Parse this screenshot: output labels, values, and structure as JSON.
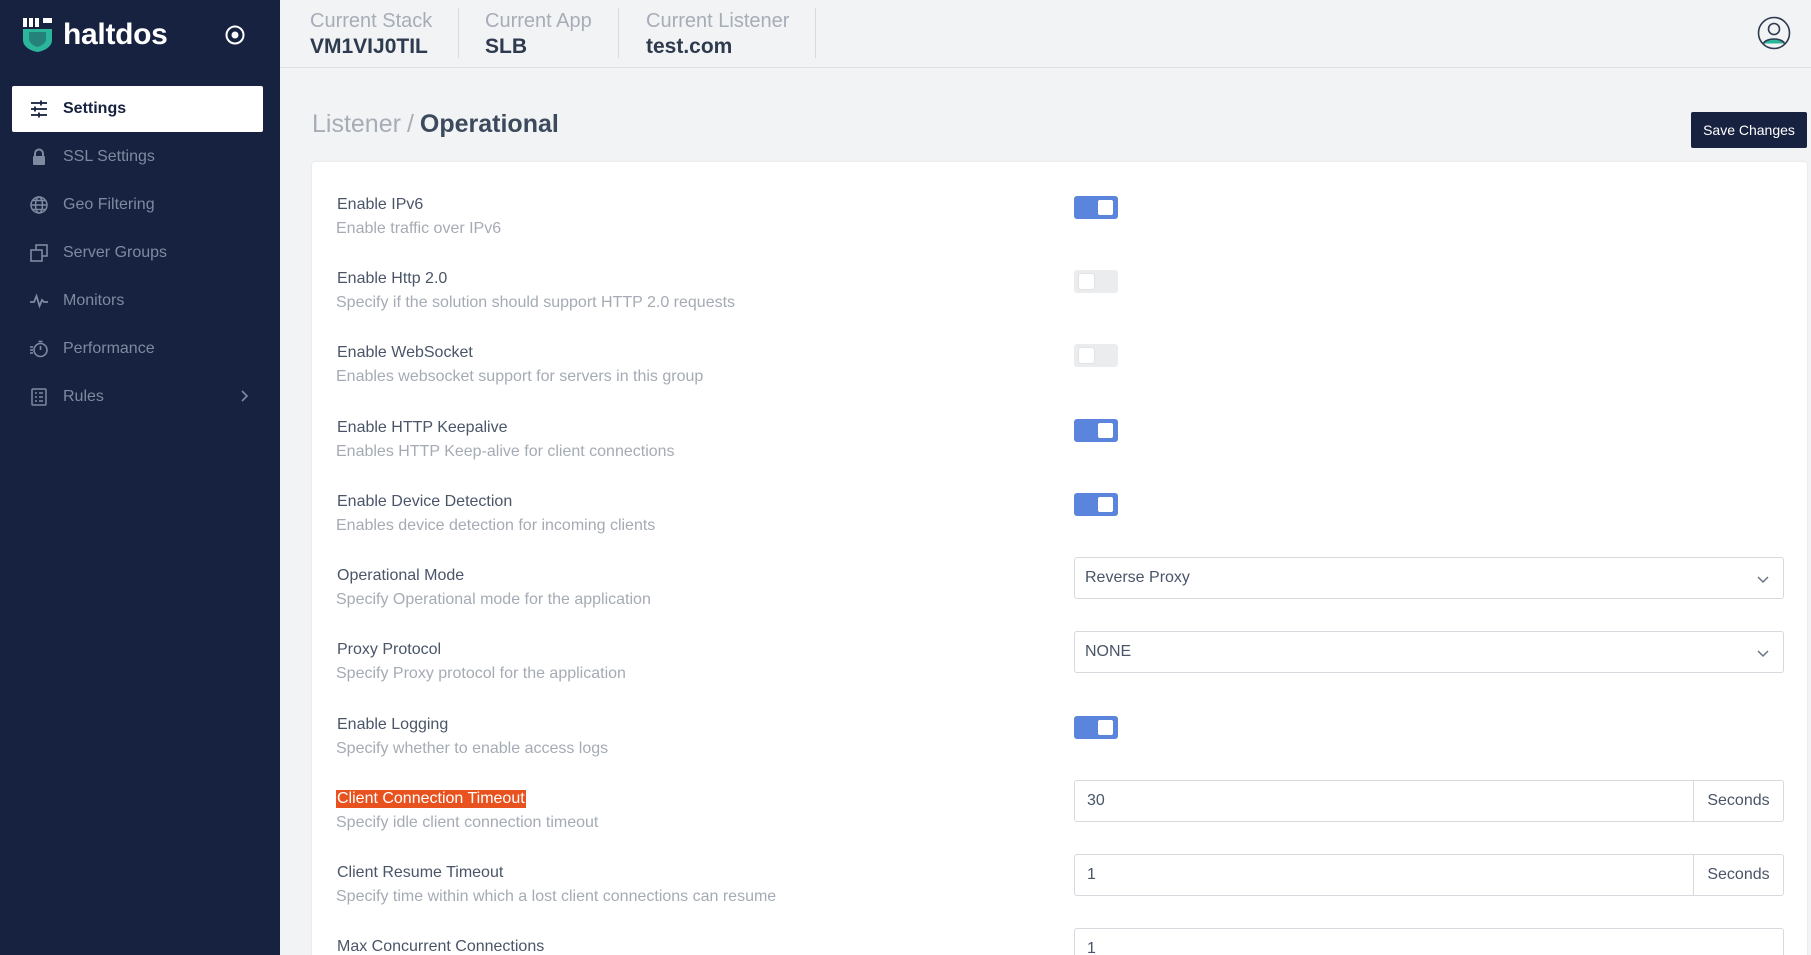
{
  "brand": {
    "name": "haltdos"
  },
  "sidebar": {
    "items": [
      {
        "label": "Settings",
        "icon": "sliders-icon",
        "active": true
      },
      {
        "label": "SSL Settings",
        "icon": "lock-icon"
      },
      {
        "label": "Geo Filtering",
        "icon": "globe-icon"
      },
      {
        "label": "Server Groups",
        "icon": "server-groups-icon"
      },
      {
        "label": "Monitors",
        "icon": "pulse-icon"
      },
      {
        "label": "Performance",
        "icon": "stopwatch-icon"
      },
      {
        "label": "Rules",
        "icon": "list-icon",
        "has_submenu": true
      }
    ]
  },
  "topbar": {
    "stack": {
      "label": "Current Stack",
      "value": "VM1VIJ0TIL"
    },
    "app": {
      "label": "Current App",
      "value": "SLB"
    },
    "listener": {
      "label": "Current Listener",
      "value": "test.com"
    }
  },
  "header": {
    "breadcrumb_parent": "Listener",
    "breadcrumb_sep": "/",
    "breadcrumb_current": "Operational",
    "save_label": "Save Changes"
  },
  "settings": {
    "ipv6": {
      "label": "Enable IPv6",
      "desc": "Enable traffic over IPv6",
      "on": true
    },
    "http2": {
      "label": "Enable Http 2.0",
      "desc": "Specify if the solution should support HTTP 2.0 requests",
      "on": false
    },
    "websocket": {
      "label": "Enable WebSocket",
      "desc": "Enables websocket support for servers in this group",
      "on": false
    },
    "keepalive": {
      "label": "Enable HTTP Keepalive",
      "desc": "Enables HTTP Keep-alive for client connections",
      "on": true
    },
    "device": {
      "label": "Enable Device Detection",
      "desc": "Enables device detection for incoming clients",
      "on": true
    },
    "mode": {
      "label": "Operational Mode",
      "desc": "Specify Operational mode for the application",
      "value": "Reverse Proxy"
    },
    "proxy_protocol": {
      "label": "Proxy Protocol",
      "desc": "Specify Proxy protocol for the application",
      "value": "NONE"
    },
    "logging": {
      "label": "Enable Logging",
      "desc": "Specify whether to enable access logs",
      "on": true
    },
    "conn_timeout": {
      "label": "Client Connection Timeout",
      "desc": "Specify idle client connection timeout",
      "value": "30",
      "unit": "Seconds"
    },
    "resume_timeout": {
      "label": "Client Resume Timeout",
      "desc": "Specify time within which a lost client connections can resume",
      "value": "1",
      "unit": "Seconds"
    },
    "max_conn": {
      "label": "Max Concurrent Connections",
      "value": "1"
    }
  },
  "colors": {
    "sidebar_bg": "#172240",
    "toggle_on": "#5b84dc",
    "highlight": "#e8521e",
    "brand_green": "#2bb59b"
  }
}
